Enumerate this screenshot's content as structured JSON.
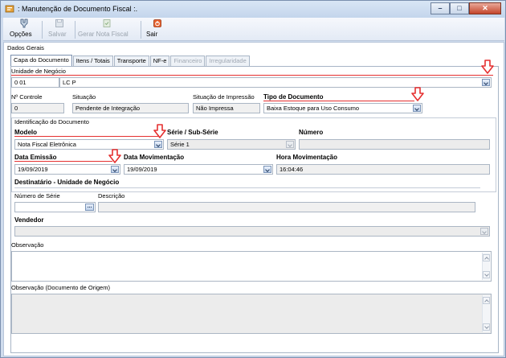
{
  "window": {
    "title": ": Manutenção de Documento Fiscal :."
  },
  "toolbar": {
    "options_label": "Opções",
    "save_label": "Salvar",
    "generate_label": "Gerar Nota Fiscal",
    "exit_label": "Sair"
  },
  "group_title": "Dados Gerais",
  "tabs": [
    "Capa do Documento",
    "Itens / Totais",
    "Transporte",
    "NF-e",
    "Financeiro",
    "Irregularidade"
  ],
  "unidade": {
    "label": "Unidade de Negócio",
    "code": "0        01",
    "name": "LC                                                          P"
  },
  "controle": {
    "label": "Nº Controle",
    "value": "0"
  },
  "situacao": {
    "label": "Situação",
    "value": "Pendente de Integração"
  },
  "situacao_impressao": {
    "label": "Situação de Impressão",
    "value": "Não Impressa"
  },
  "tipo_documento": {
    "label": "Tipo de Documento",
    "value": "Baixa Estoque para Uso Consumo"
  },
  "identificacao_title": "Identificação do Documento",
  "modelo": {
    "label": "Modelo",
    "value": "Nota Fiscal Eletrônica"
  },
  "serie": {
    "label": "Série / Sub-Série",
    "value": "Série 1"
  },
  "numero": {
    "label": "Número",
    "value": ""
  },
  "data_emissao": {
    "label": "Data Emissão",
    "value": "19/09/2019"
  },
  "data_movimentacao": {
    "label": "Data Movimentação",
    "value": "19/09/2019"
  },
  "hora_movimentacao": {
    "label": "Hora Movimentação",
    "value": "16:04:46"
  },
  "destinatario_title": "Destinatário - Unidade de Negócio",
  "numero_serie": {
    "label": "Número de Série",
    "value": ""
  },
  "descricao": {
    "label": "Descrição",
    "value": ""
  },
  "vendedor": {
    "label": "Vendedor",
    "value": ""
  },
  "observacao": {
    "label": "Observação",
    "value": ""
  },
  "observacao_origem": {
    "label": "Observação (Documento de Origem)",
    "value": ""
  },
  "colors": {
    "annotation_red": "#e53030",
    "window_blue": "#cfdced"
  }
}
